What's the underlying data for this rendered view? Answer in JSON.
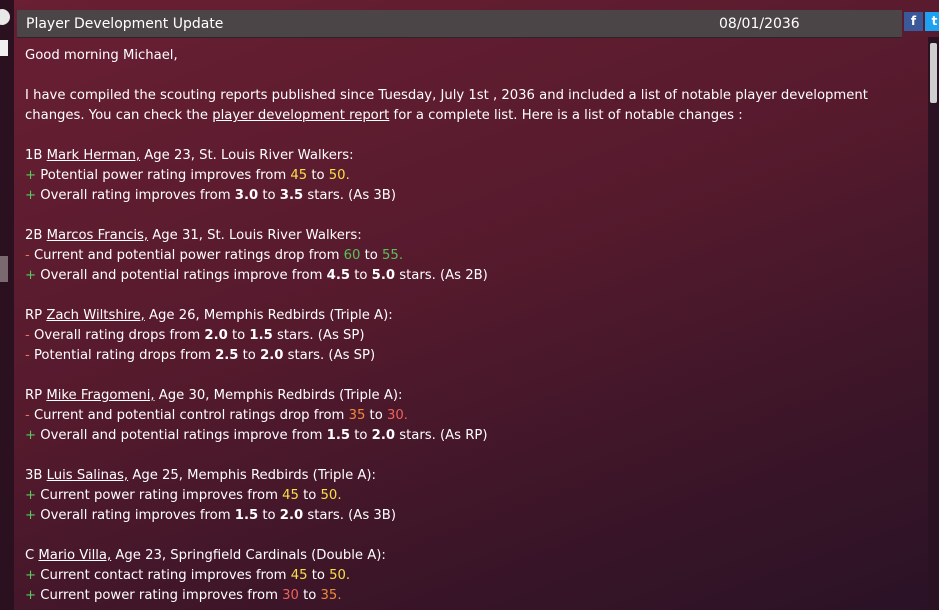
{
  "window": {
    "title": "Player Development Update",
    "date": "08/01/2036"
  },
  "share": {
    "facebook": "f",
    "twitter": "t"
  },
  "colors": {
    "background": "#5a1c30",
    "header": "#4b4548",
    "plus": "#5ac85a",
    "minus": "#ff6a5a",
    "yellow": "#f5e04a",
    "green": "#58c258",
    "orange": "#ee8a3a",
    "red": "#f0605a"
  },
  "greeting": "Good morning Michael,",
  "intro": {
    "part1": "I have compiled the scouting reports published since Tuesday, July 1st , 2036 and included a list of notable player development changes. You can check the ",
    "link": "player development report",
    "part2": " for a complete list. Here is a list of notable changes :"
  },
  "players": [
    {
      "pos": "1B",
      "name": "Mark Herman,",
      "info": " Age 23, St. Louis River Walkers:",
      "changes": [
        {
          "sign": "+",
          "pre": "Potential power rating improves from ",
          "from": "45",
          "from_color": "yellow",
          "mid": " to ",
          "to": "50",
          "to_color": "yellow",
          "post": ".",
          "post_color": "yellow",
          "bold": false
        },
        {
          "sign": "+",
          "pre": "Overall rating improves from ",
          "from": "3.0",
          "mid": " to ",
          "to": "3.5",
          "post": " stars. (As 3B)",
          "bold": true
        }
      ]
    },
    {
      "pos": "2B",
      "name": "Marcos Francis,",
      "info": " Age 31, St. Louis River Walkers:",
      "changes": [
        {
          "sign": "-",
          "pre": "Current and potential power ratings drop from ",
          "from": "60",
          "from_color": "green",
          "mid": " to ",
          "to": "55",
          "to_color": "green",
          "post": ".",
          "post_color": "green",
          "bold": false
        },
        {
          "sign": "+",
          "pre": "Overall and potential ratings improve from ",
          "from": "4.5",
          "mid": " to ",
          "to": "5.0",
          "post": " stars. (As 2B)",
          "bold": true
        }
      ]
    },
    {
      "pos": "RP",
      "name": "Zach Wiltshire,",
      "info": " Age 26, Memphis Redbirds (Triple A):",
      "changes": [
        {
          "sign": "-",
          "pre": "Overall rating drops from ",
          "from": "2.0",
          "mid": " to ",
          "to": "1.5",
          "post": " stars. (As SP)",
          "bold": true
        },
        {
          "sign": "-",
          "pre": "Potential rating drops from ",
          "from": "2.5",
          "mid": " to ",
          "to": "2.0",
          "post": " stars. (As SP)",
          "bold": true
        }
      ]
    },
    {
      "pos": "RP",
      "name": "Mike Fragomeni,",
      "info": " Age 30, Memphis Redbirds (Triple A):",
      "changes": [
        {
          "sign": "-",
          "pre": "Current and potential control ratings drop from ",
          "from": "35",
          "from_color": "orange",
          "mid": " to ",
          "to": "30",
          "to_color": "red",
          "post": ".",
          "post_color": "red",
          "bold": false
        },
        {
          "sign": "+",
          "pre": "Overall and potential ratings improve from ",
          "from": "1.5",
          "mid": " to ",
          "to": "2.0",
          "post": " stars. (As RP)",
          "bold": true
        }
      ]
    },
    {
      "pos": "3B",
      "name": "Luis Salinas,",
      "info": " Age 25, Memphis Redbirds (Triple A):",
      "changes": [
        {
          "sign": "+",
          "pre": "Current power rating improves from ",
          "from": "45",
          "from_color": "yellow",
          "mid": " to ",
          "to": "50",
          "to_color": "yellow",
          "post": ".",
          "post_color": "yellow",
          "bold": false
        },
        {
          "sign": "+",
          "pre": "Overall rating improves from ",
          "from": "1.5",
          "mid": " to ",
          "to": "2.0",
          "post": " stars. (As 3B)",
          "bold": true
        }
      ]
    },
    {
      "pos": "C",
      "name": "Mario Villa,",
      "info": " Age 23, Springfield Cardinals (Double A):",
      "changes": [
        {
          "sign": "+",
          "pre": "Current contact rating improves from ",
          "from": "45",
          "from_color": "yellow",
          "mid": " to ",
          "to": "50",
          "to_color": "yellow",
          "post": ".",
          "post_color": "yellow",
          "bold": false
        },
        {
          "sign": "+",
          "pre": "Current power rating improves from ",
          "from": "30",
          "from_color": "red",
          "mid": " to ",
          "to": "35",
          "to_color": "orange",
          "post": ".",
          "post_color": "orange",
          "bold": false
        }
      ]
    }
  ]
}
